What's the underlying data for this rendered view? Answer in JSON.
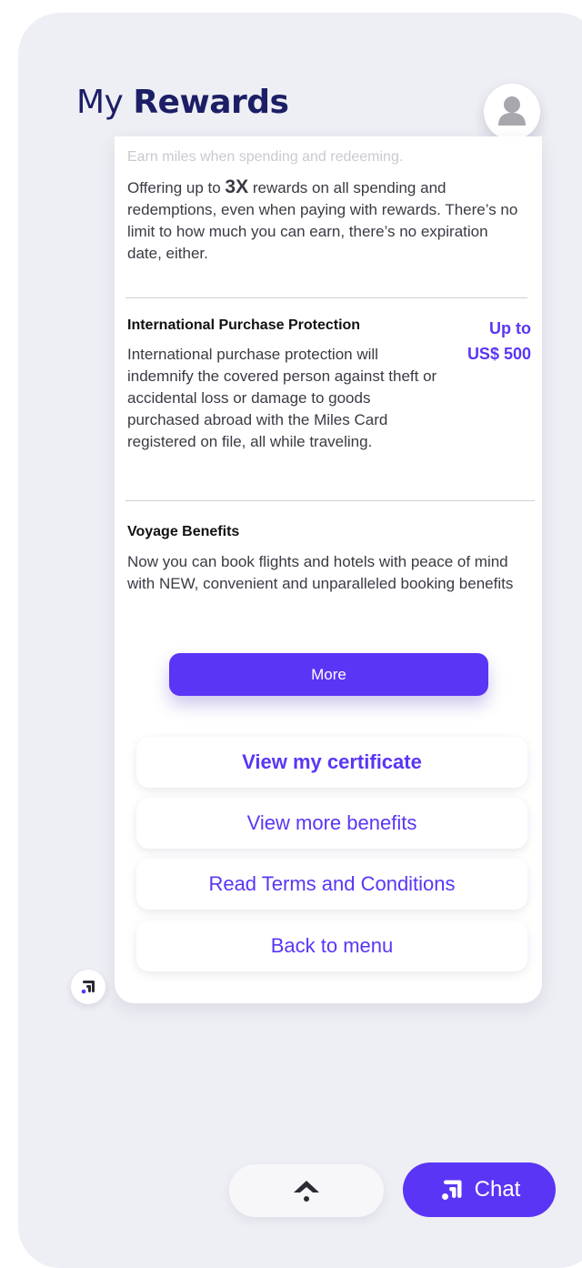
{
  "header": {
    "title_prefix": "My",
    "title_bold": "Rewards"
  },
  "rewards": {
    "faded_line": "Earn miles when spending and redeeming.",
    "intro_before": "Offering up to ",
    "intro_highlight": "3X",
    "intro_after": " rewards on all spending and redemptions, even when paying with rewards. There’s no limit to how much you can earn, there’s no expiration date, either.",
    "items": [
      {
        "title": "International Purchase Protection",
        "amount_line1": "Up to",
        "amount_line2": "US$ 500",
        "description": "International purchase protection will indemnify the covered person against theft or accidental loss or damage to goods purchased abroad with the Miles Card registered on file, all while traveling."
      },
      {
        "title": "Voyage Benefits",
        "description": "Now you can book flights and hotels with peace of mind with NEW, convenient and unparalleled booking benefits"
      }
    ],
    "more_label": "More"
  },
  "actions": {
    "certificate": "View my certificate",
    "more_benefits": "View more benefits",
    "terms": "Read Terms and Conditions",
    "back": "Back to menu"
  },
  "footer": {
    "chat_label": "Chat"
  },
  "icons": {
    "avatar": "user-avatar-icon",
    "scroll_up": "chevron-up-icon",
    "brand": "brand-logo-icon"
  },
  "colors": {
    "accent": "#5b35f5",
    "title": "#1c1f66",
    "background": "#eeeff4"
  }
}
